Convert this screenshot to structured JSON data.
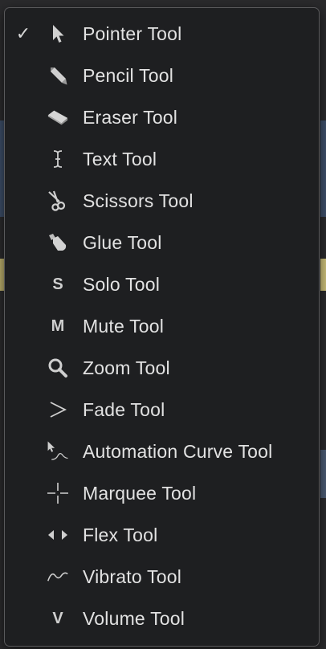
{
  "menu": {
    "checked_mark": "✓",
    "items": [
      {
        "label": "Pointer Tool",
        "icon": "pointer-icon",
        "checked": true
      },
      {
        "label": "Pencil Tool",
        "icon": "pencil-icon",
        "checked": false
      },
      {
        "label": "Eraser Tool",
        "icon": "eraser-icon",
        "checked": false
      },
      {
        "label": "Text Tool",
        "icon": "text-cursor-icon",
        "checked": false
      },
      {
        "label": "Scissors Tool",
        "icon": "scissors-icon",
        "checked": false
      },
      {
        "label": "Glue Tool",
        "icon": "glue-icon",
        "checked": false
      },
      {
        "label": "Solo Tool",
        "icon": "solo-icon",
        "glyph": "S",
        "checked": false
      },
      {
        "label": "Mute Tool",
        "icon": "mute-icon",
        "glyph": "M",
        "checked": false
      },
      {
        "label": "Zoom Tool",
        "icon": "magnifier-icon",
        "checked": false
      },
      {
        "label": "Fade Tool",
        "icon": "fade-icon",
        "checked": false
      },
      {
        "label": "Automation Curve Tool",
        "icon": "automation-curve-icon",
        "checked": false
      },
      {
        "label": "Marquee Tool",
        "icon": "marquee-crosshair-icon",
        "checked": false
      },
      {
        "label": "Flex Tool",
        "icon": "flex-arrows-icon",
        "checked": false
      },
      {
        "label": "Vibrato Tool",
        "icon": "vibrato-wave-icon",
        "checked": false
      },
      {
        "label": "Volume Tool",
        "icon": "volume-icon",
        "glyph": "V",
        "checked": false
      }
    ]
  }
}
